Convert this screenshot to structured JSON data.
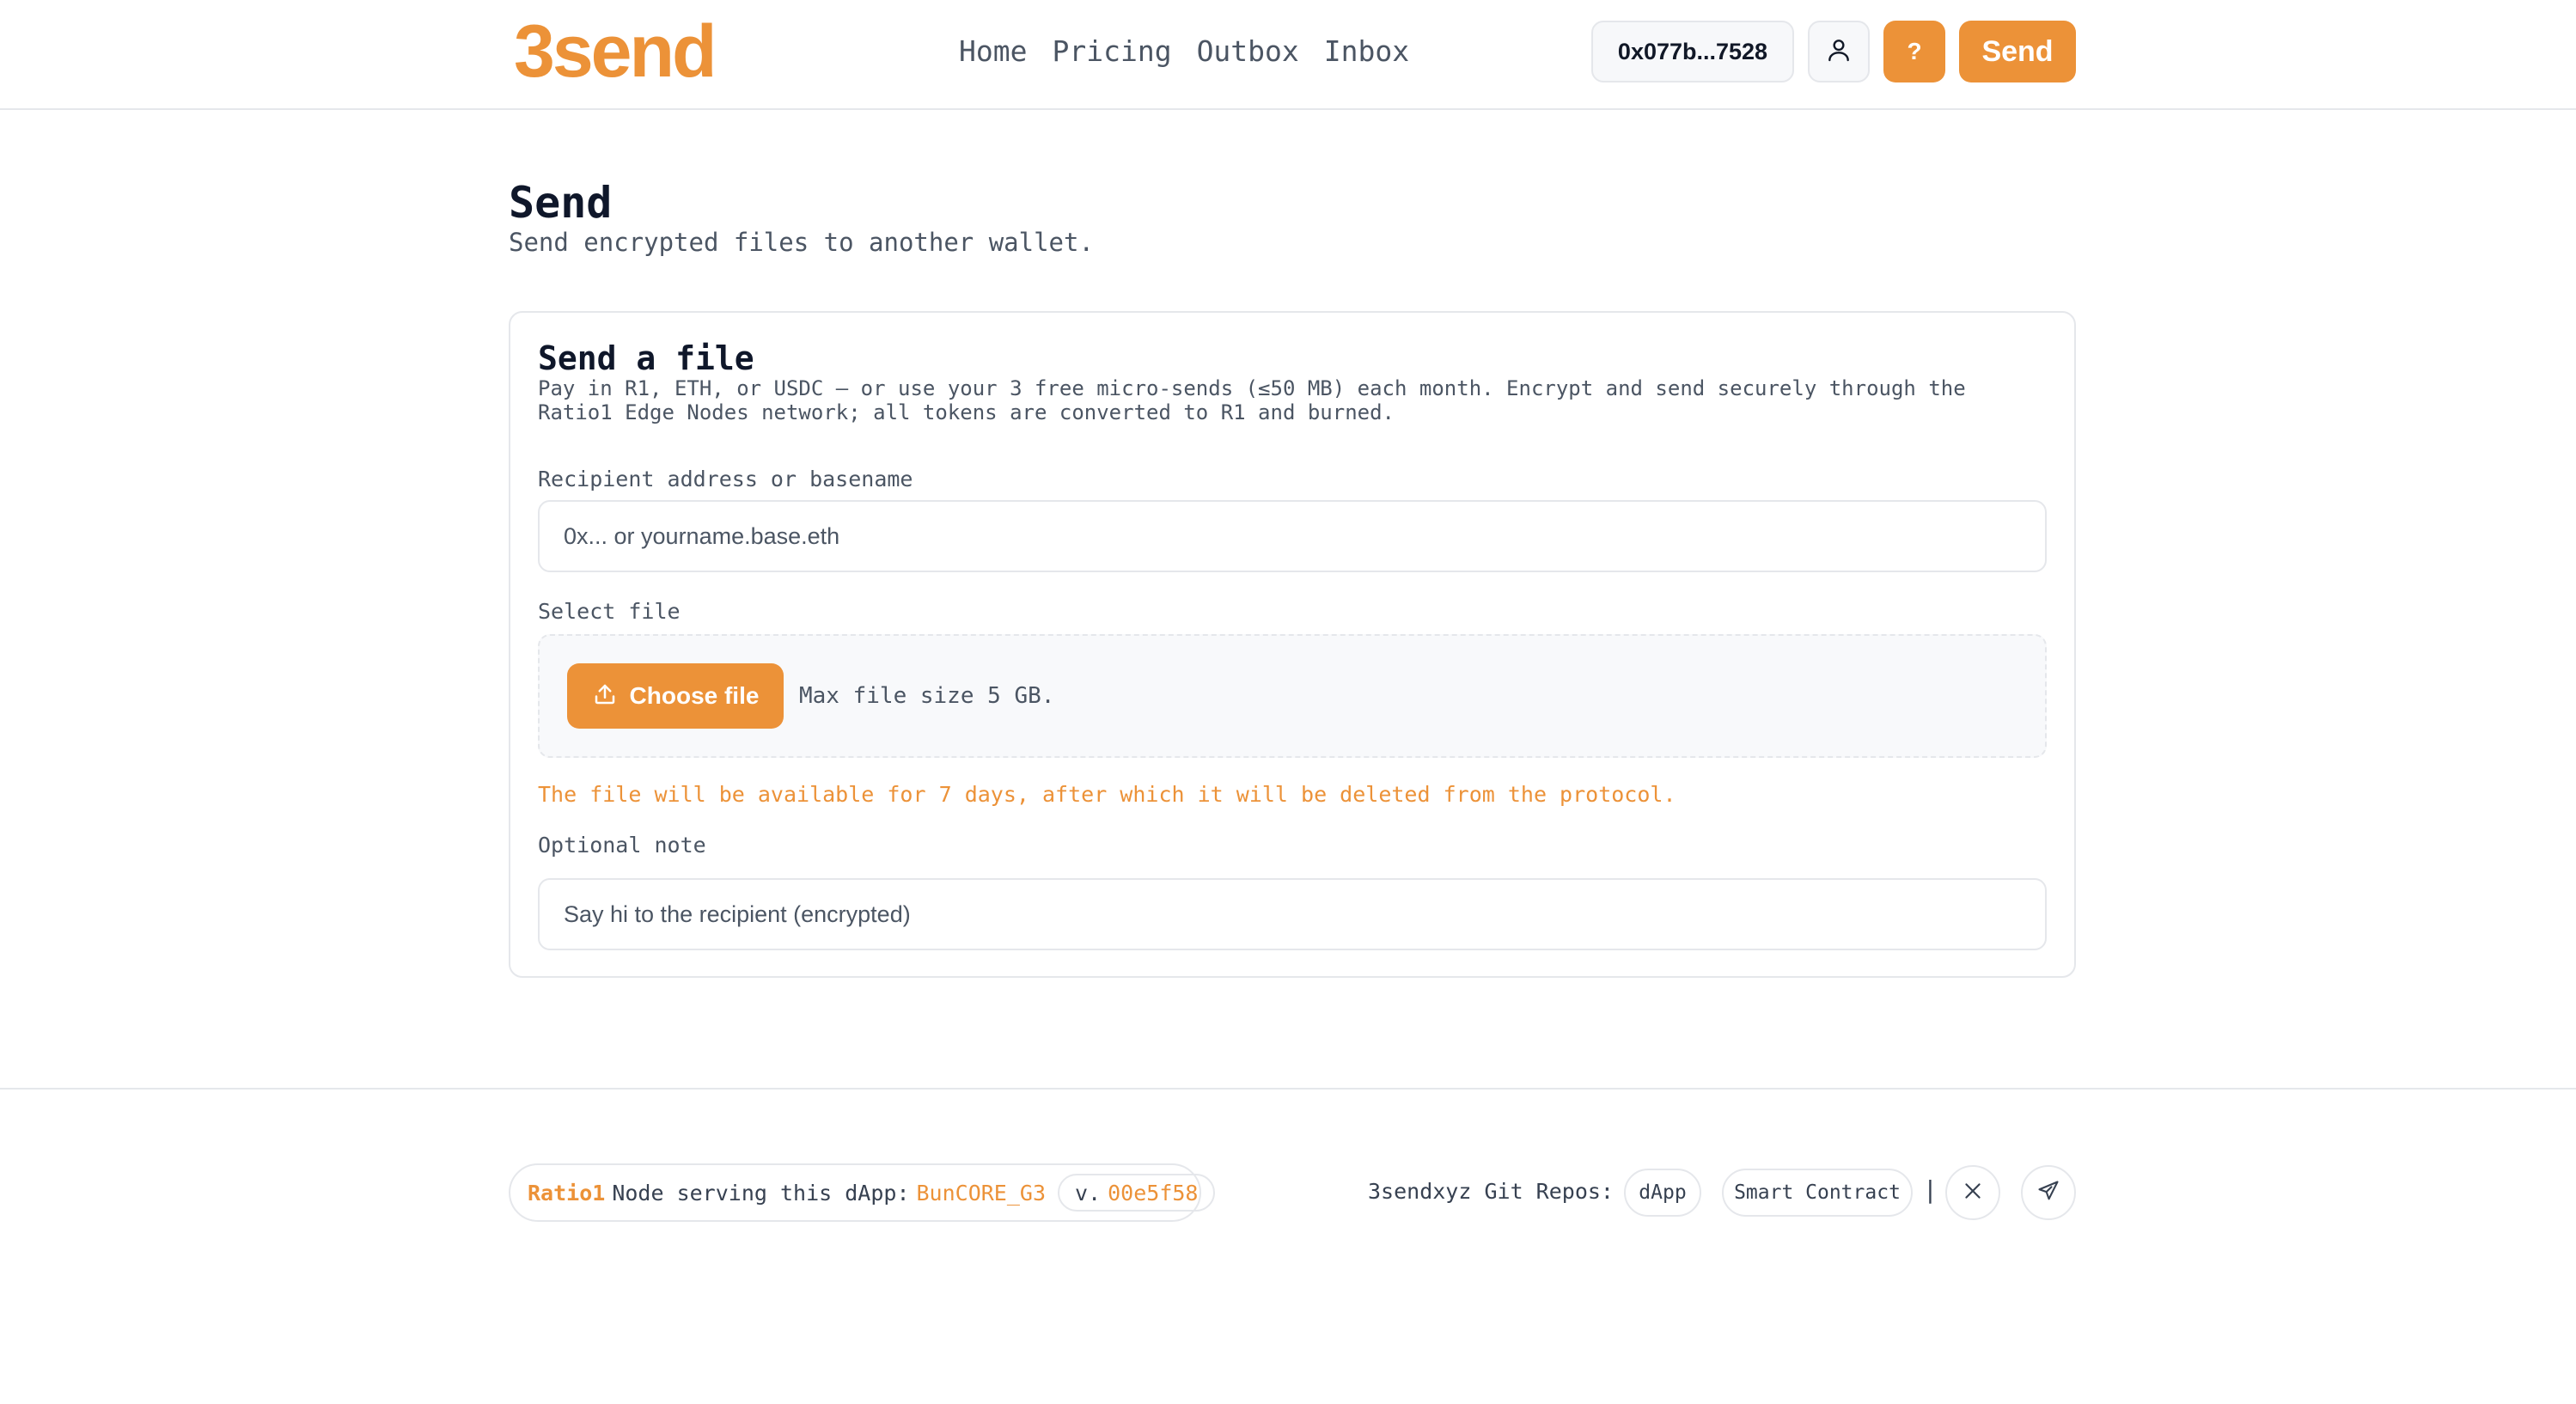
{
  "header": {
    "logo": "3send",
    "nav": [
      "Home",
      "Pricing",
      "Outbox",
      "Inbox"
    ],
    "wallet": "0x077b...7528",
    "help_label": "?",
    "send_label": "Send",
    "user_icon": "user-icon"
  },
  "page": {
    "title": "Send",
    "subtitle": "Send encrypted files to another wallet."
  },
  "card": {
    "title": "Send a file",
    "description": "Pay in R1, ETH, or USDC — or use your 3 free micro-sends (≤50 MB) each month. Encrypt and send securely through the Ratio1 Edge Nodes network; all tokens are converted to R1 and burned.",
    "recipient_label": "Recipient address or basename",
    "recipient_placeholder": "0x... or yourname.base.eth",
    "recipient_value": "",
    "file_label": "Select file",
    "choose_file_label": "Choose file",
    "upload_icon": "upload-icon",
    "max_size": "Max file size 5 GB.",
    "notice": "The file will be available for 7 days, after which it will be deleted from the protocol.",
    "note_label": "Optional note",
    "note_placeholder": "Say hi to the recipient (encrypted)",
    "note_value": ""
  },
  "footer": {
    "brand": "Ratio1",
    "node_text": "Node serving this dApp:",
    "node_name": "BunCORE_G3",
    "version_prefix": "v.",
    "version_hash": "00e5f58",
    "repos_label": "3sendxyz Git Repos:",
    "repos": [
      "dApp",
      "Smart Contract"
    ],
    "separator": "|",
    "social_icons": [
      "x-icon",
      "telegram-icon"
    ]
  },
  "colors": {
    "accent": "#ec9238",
    "text": "#111827",
    "muted": "#4b5563",
    "border": "#e5e7eb"
  }
}
